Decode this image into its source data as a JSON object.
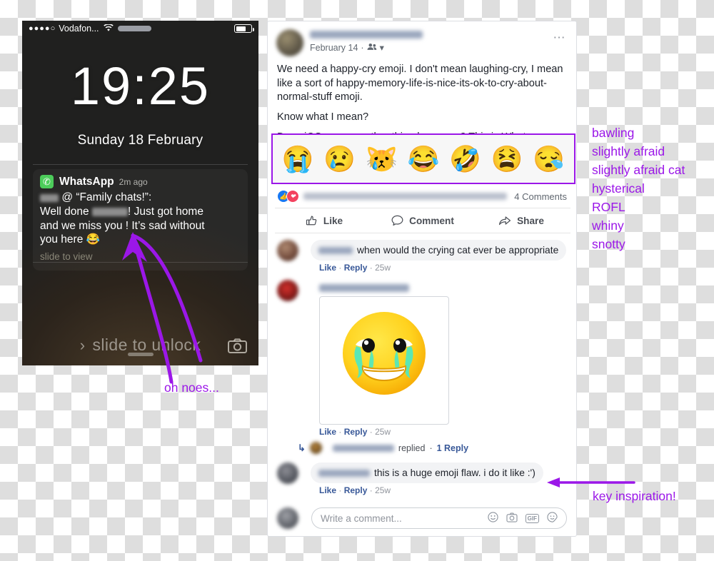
{
  "phone": {
    "status": {
      "signal_dots": "●●●●○",
      "carrier": "Vodafon...",
      "wifi_icon": "wifi-icon",
      "battery_icon": "battery-icon"
    },
    "time": "19:25",
    "date": "Sunday 18 February",
    "notification": {
      "app_icon": "whatsapp-icon",
      "app_name": "WhatsApp",
      "time_ago": "2m ago",
      "line1_suffix": "@ “Family chats!”:",
      "line2_prefix": "Well done",
      "line2_suffix": "! Just got home",
      "line3": "and we miss you ! It’s sad without",
      "line4": "you here",
      "line4_emoji": "😂",
      "slide_hint": "slide to view"
    },
    "slide_to_unlock": "slide to unlock",
    "chevron_icon": "chevron-right-icon",
    "camera_icon": "camera-icon"
  },
  "facebook": {
    "post": {
      "date": "February 14",
      "audience_icon": "friends-icon",
      "audience_caret": "chevron-down-icon",
      "menu_icon": "ellipsis-icon",
      "paragraphs": [
        "We need a happy-cry emoji. I don't mean laughing-cry, I mean like a sort of happy-memory-life-is-nice-its-ok-to-cry-about-normal-stuff emoji.",
        "Know what I mean?",
        "Does iOS or some other thing have one? This is Whatsapp."
      ],
      "emoji_row": [
        "😭",
        "😢",
        "😿",
        "😂",
        "🤣",
        "😫",
        "😪"
      ]
    },
    "reactions": {
      "like_icon": "thumbs-up-icon",
      "love_icon": "heart-icon",
      "comment_count": "4 Comments"
    },
    "actions": [
      {
        "label": "Like",
        "icon": "thumbs-up-icon"
      },
      {
        "label": "Comment",
        "icon": "comment-bubble-icon"
      },
      {
        "label": "Share",
        "icon": "share-arrow-icon"
      }
    ],
    "comments": [
      {
        "text": "when would the crying cat ever be appropriate",
        "like": "Like",
        "reply": "Reply",
        "age": "25w"
      },
      {
        "text": "",
        "photo_emoji": "😂",
        "like": "Like",
        "reply": "Reply",
        "age": "25w",
        "reply_line": {
          "replied": "replied",
          "count": "1 Reply",
          "arrow_icon": "reply-arrow-icon"
        }
      },
      {
        "text": "this is a huge emoji flaw. i do it like :')",
        "like": "Like",
        "reply": "Reply",
        "age": "25w"
      }
    ],
    "composer": {
      "placeholder": "Write a comment...",
      "tools": [
        {
          "name": "emoji-icon",
          "glyph": "☺"
        },
        {
          "name": "camera-icon",
          "glyph": "□"
        },
        {
          "name": "gif-icon",
          "glyph": "GIF"
        },
        {
          "name": "sticker-icon",
          "glyph": "◯"
        }
      ]
    }
  },
  "annotations": {
    "accent_color": "#9b17e8",
    "emoji_labels": [
      "bawling",
      "slightly afraid",
      "slightly afraid cat",
      "hysterical",
      "ROFL",
      "whiny",
      "snotty"
    ],
    "oh_noes": "oh noes...",
    "key_inspiration": "key inspiration!"
  }
}
